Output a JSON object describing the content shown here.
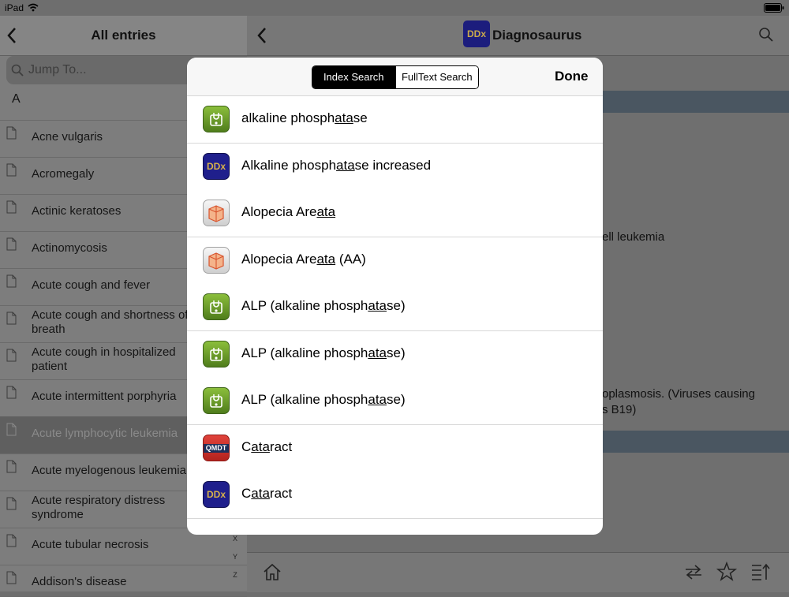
{
  "status_bar": {
    "device": "iPad"
  },
  "sidebar": {
    "title": "All entries",
    "search_placeholder": "Jump To...",
    "section_letter": "A",
    "entries": [
      "Acne vulgaris",
      "Acromegaly",
      "Actinic keratoses",
      "Actinomycosis",
      "Acute cough and fever",
      "Acute cough and shortness of breath",
      "Acute cough in hospitalized patient",
      "Acute intermittent porphyria",
      "Acute lymphocytic leukemia",
      "Acute myelogenous leukemia",
      "Acute respiratory distress syndrome",
      "Acute tubular necrosis",
      "Addison's disease"
    ],
    "selected_index": 8,
    "index_letters": [
      "X",
      "Y",
      "Z"
    ]
  },
  "detail": {
    "app_icon_text": "DDx",
    "app_title": "Diagnosaurus",
    "fragment_1": "ell leukemia",
    "fragment_2a": "oplasmosis. (Viruses causing",
    "fragment_2b": "s B19)"
  },
  "modal": {
    "segments": [
      "Index Search",
      "FullText Search"
    ],
    "active_segment": 0,
    "done_label": "Done",
    "results": [
      {
        "icon": "stethoscope-icon",
        "pre": "alkaline phosph",
        "match": "ata",
        "post": "se"
      },
      {
        "icon": "ddx-icon",
        "icon_text": "DDx",
        "pre": "Alkaline phosph",
        "match": "ata",
        "post": "se increased"
      },
      {
        "icon": "book-icon",
        "pre": "Alopecia Are",
        "match": "ata",
        "post": ""
      },
      {
        "icon": "book-icon",
        "pre": "Alopecia Are",
        "match": "ata",
        "post": " (AA)"
      },
      {
        "icon": "stethoscope-icon",
        "pre": "ALP (alkaline phosph",
        "match": "ata",
        "post": "se)"
      },
      {
        "icon": "stethoscope-icon",
        "pre": "ALP (alkaline phosph",
        "match": "ata",
        "post": "se)"
      },
      {
        "icon": "stethoscope-icon",
        "pre": "ALP (alkaline phosph",
        "match": "ata",
        "post": "se)"
      },
      {
        "icon": "qmdt-icon",
        "icon_text": "QMDT",
        "pre": "C",
        "match": "ata",
        "post": "ract"
      },
      {
        "icon": "ddx-icon",
        "icon_text": "DDx",
        "pre": "C",
        "match": "ata",
        "post": "ract"
      }
    ]
  },
  "colors": {
    "ddx_blue": "#1f1f8c",
    "ddx_gold": "#d8b24a",
    "green_icon": "#6a9a2a",
    "qmdt_red": "#c9302a"
  }
}
